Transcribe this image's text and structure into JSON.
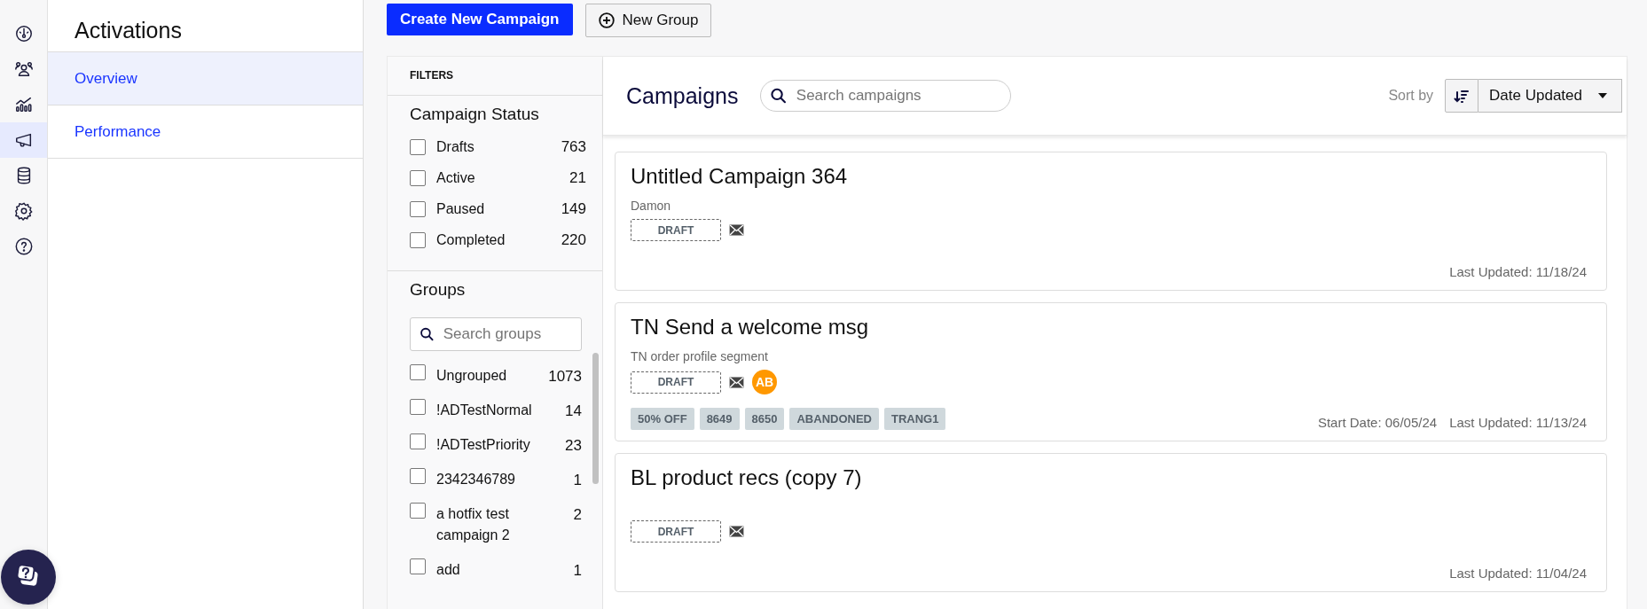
{
  "rail": [
    {
      "selected": false
    },
    {
      "selected": false
    },
    {
      "selected": false
    },
    {
      "selected": true
    },
    {
      "selected": false
    },
    {
      "selected": false
    },
    {
      "selected": false
    }
  ],
  "nav": {
    "title": "Activations",
    "items": [
      {
        "label": "Overview",
        "selected": true
      },
      {
        "label": "Performance",
        "selected": false
      }
    ]
  },
  "toolbar": {
    "create_button": "Create New Campaign",
    "group_button": "New Group"
  },
  "filters": {
    "header": "FILTERS",
    "status": {
      "title": "Campaign Status",
      "options": [
        {
          "label": "Drafts",
          "count": "763",
          "checked": false
        },
        {
          "label": "Active",
          "count": "21",
          "checked": false
        },
        {
          "label": "Paused",
          "count": "149",
          "checked": false
        },
        {
          "label": "Completed",
          "count": "220",
          "checked": false
        }
      ]
    },
    "groups": {
      "title": "Groups",
      "search": {
        "placeholder": "Search groups"
      },
      "options": [
        {
          "label": "Ungrouped",
          "count": "1073",
          "checked": false
        },
        {
          "label": "!ADTestNormal",
          "count": "14",
          "checked": false
        },
        {
          "label": "!ADTestPriority",
          "count": "23",
          "checked": false
        },
        {
          "label": "2342346789",
          "count": "1",
          "checked": false
        },
        {
          "label": "a hotfix test campaign 2",
          "count": "2",
          "checked": false
        },
        {
          "label": "add",
          "count": "1",
          "checked": false
        }
      ]
    }
  },
  "campaigns": {
    "title": "Campaigns",
    "search": {
      "placeholder": "Search campaigns"
    },
    "sort_label": "Sort by",
    "sort_value": "Date Updated",
    "cards": [
      {
        "title": "Untitled Campaign 364",
        "subtitle": "Damon",
        "status": "DRAFT",
        "last_updated": "Last Updated: 11/18/24"
      },
      {
        "title": "TN Send a welcome msg",
        "subtitle": "TN order profile segment",
        "status": "DRAFT",
        "badge": "AB",
        "tags": [
          "50% OFF",
          "8649",
          "8650",
          "ABANDONED",
          "TRANG1"
        ],
        "start_date": "Start Date: 06/05/24",
        "last_updated": "Last Updated: 11/13/24"
      },
      {
        "title": "BL product recs (copy 7)",
        "status": "DRAFT",
        "last_updated": "Last Updated: 11/04/24"
      }
    ]
  }
}
